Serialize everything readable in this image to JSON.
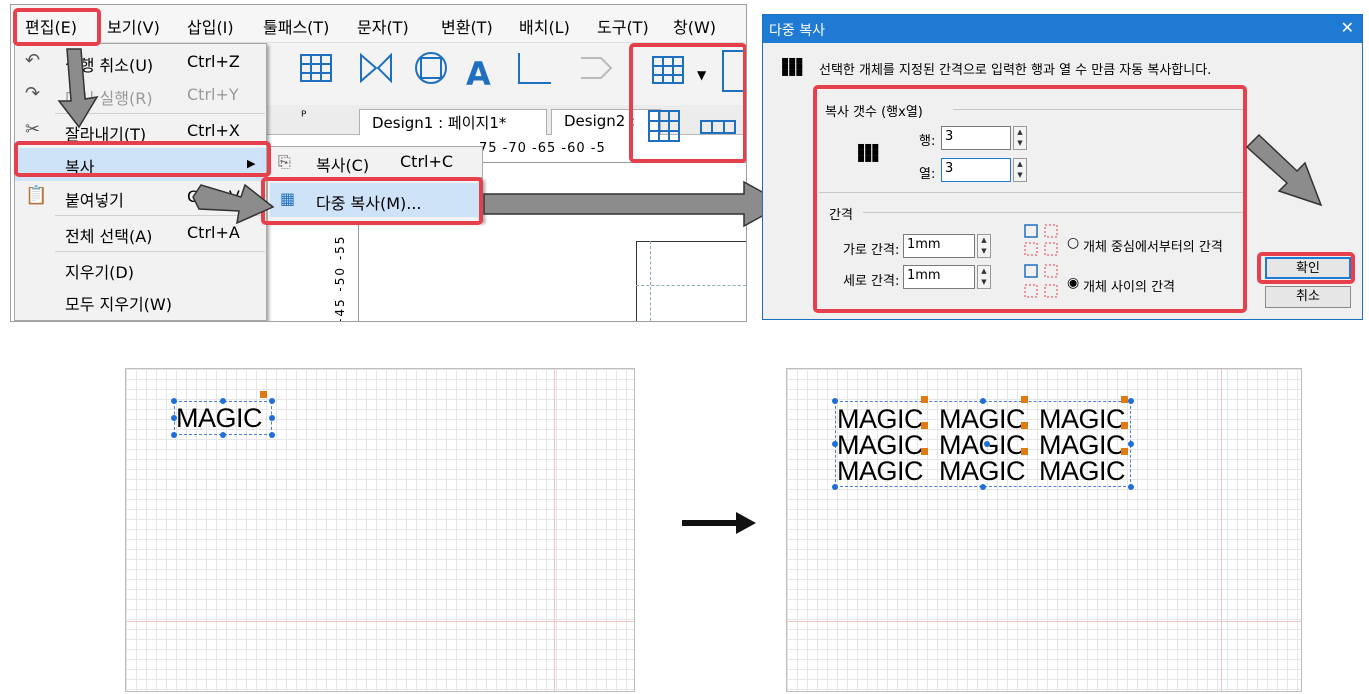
{
  "menubar": {
    "items": [
      "편집(E)",
      "보기(V)",
      "삽입(I)",
      "툴패스(T)",
      "문자(T)",
      "변환(T)",
      "배치(L)",
      "도구(T)",
      "창(W)"
    ]
  },
  "tabs": [
    "Design1 : 페이지1*",
    "Design2 :"
  ],
  "ruler": {
    "top": "75 -70 -65 -60 -5",
    "left": "-45 -50 -55"
  },
  "edit_menu": {
    "items": [
      {
        "label": "실행 취소(U)",
        "shortcut": "Ctrl+Z",
        "icon": "undo-icon"
      },
      {
        "label": "다시 실행(R)",
        "shortcut": "Ctrl+Y",
        "icon": "redo-icon"
      },
      {
        "label": "잘라내기(T)",
        "shortcut": "Ctrl+X",
        "icon": "cut-icon"
      },
      {
        "label": "복사",
        "shortcut": "",
        "icon": "copy-icon"
      },
      {
        "label": "붙여넣기",
        "shortcut": "Ctrl+V",
        "icon": "paste-icon"
      },
      {
        "label": "전체 선택(A)",
        "shortcut": "Ctrl+A",
        "icon": ""
      },
      {
        "label": "지우기(D)",
        "shortcut": "",
        "icon": ""
      },
      {
        "label": "모두 지우기(W)",
        "shortcut": "",
        "icon": ""
      }
    ],
    "submenu_arrow": "▶"
  },
  "copy_submenu": {
    "items": [
      {
        "label": "복사(C)",
        "shortcut": "Ctrl+C"
      },
      {
        "label": "다중 복사(M)...",
        "shortcut": ""
      }
    ]
  },
  "dialog": {
    "title": "다중 복사",
    "close": "✕",
    "description": "선택한 개체를 지정된 간격으로 입력한 행과 열 수 만큼 자동 복사합니다.",
    "count_group": "복사 갯수 (행x열)",
    "row_label": "행:",
    "row_value": "3",
    "col_label": "열:",
    "col_value": "3",
    "spacing_group": "간격",
    "h_spacing_label": "가로 간격:",
    "h_spacing_value": "1mm",
    "v_spacing_label": "세로 간격:",
    "v_spacing_value": "1mm",
    "option_center": "개체 중심에서부터의 간격",
    "option_between": "개체 사이의 간격",
    "selected_option": "option_between",
    "ok": "확인",
    "cancel": "취소"
  },
  "canvas_before": {
    "text": "MAGIC"
  },
  "canvas_after": {
    "rows": [
      [
        "MAGIC",
        "MAGIC",
        "MAGIC"
      ],
      [
        "MAGIC",
        "MAGIC",
        "MAGIC"
      ],
      [
        "MAGIC",
        "MAGIC",
        "MAGIC"
      ]
    ]
  },
  "colors": {
    "highlight_red": "#e5404b",
    "accent_blue": "#1f7ad4",
    "arrow_gray": "#8c8c8c",
    "handle_orange": "#e07a12"
  }
}
